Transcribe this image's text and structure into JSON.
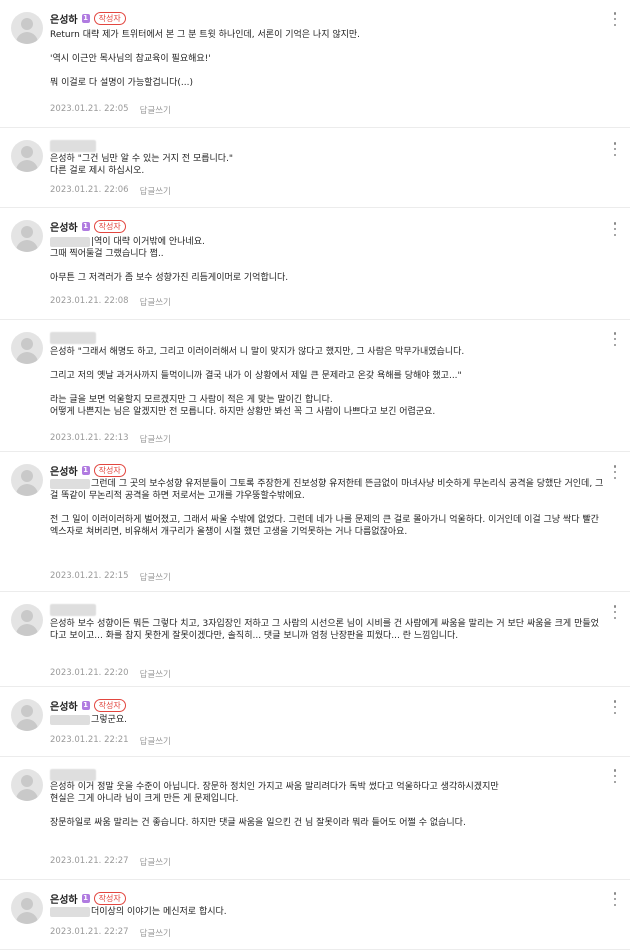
{
  "labels": {
    "writer_badge": "작성자",
    "reply": "답글쓰기",
    "level": "1"
  },
  "comments": [
    {
      "author": "은성하",
      "writer": true,
      "lines": [
        {
          "text": "Return 대략 제가 트위터에서 본 그 분 트윗 하나인데, 서론이 기억은 나지 않지만."
        },
        {
          "text": ""
        },
        {
          "text": "'역시 이근안 목사님의 참교육이 필요해요!'"
        },
        {
          "text": ""
        },
        {
          "text": "뭐 이걸로 다 설명이 가능할겁니다(...)"
        }
      ],
      "date": "2023.01.21. 22:05"
    },
    {
      "author": "은성하",
      "writer": false,
      "hidden_name": true,
      "lines": [
        {
          "text": "은성하 \"그건 님만 알 수 있는 거지 전 모릅니다.\""
        },
        {
          "text": "다른 걸로 제시 하십시오."
        }
      ],
      "date": "2023.01.21. 22:06"
    },
    {
      "author": "은성하",
      "writer": true,
      "lines": [
        {
          "text": "|역이 대략 이거밖에 안나네요.",
          "blur": true
        },
        {
          "text": "그때 찍어둘걸 그랬습니다 쩝.."
        },
        {
          "text": ""
        },
        {
          "text": "아무튼 그 저격러가 좀 보수 성향가진 리듬게이머로 기억합니다."
        }
      ],
      "date": "2023.01.21. 22:08"
    },
    {
      "author": "은성하",
      "writer": false,
      "hidden_name": true,
      "lines": [
        {
          "text": "은성하 \"그래서 해명도 하고, 그리고 이러이러해서 니 말이 맞지가 않다고 했지만, 그 사람은 막무가내였습니다."
        },
        {
          "text": ""
        },
        {
          "text": "그리고 저의 옛날 과거사까지 들먹이니까 결국 내가 이 상황에서 제일 큰 문제라고 온갖 욕해를 당해야 했고...\""
        },
        {
          "text": ""
        },
        {
          "text": "라는 글을 보면 억울할지 모르겠지만 그 사람이 적은 게 맞는 말이긴 합니다."
        },
        {
          "text": "어떻게 나쁜지는 님은 알겠지만 전 모릅니다. 하지만 상황만 봐선 꼭 그 사람이 나쁘다고 보긴 어렵군요."
        }
      ],
      "date": "2023.01.21. 22:13"
    },
    {
      "author": "은성하",
      "writer": true,
      "lines": [
        {
          "text": "그런데 그 곳의 보수성향 유저분들이 그토록 주장한게 진보성향 유저한테 뜬금없이 마녀사냥 비슷하게 무논리식 공격을 당했단 거인데, 그걸 똑같이 무논리적 공격을 하면 저로서는 고개를 갸우뚱할수밖에요.",
          "blur": true,
          "wrap": true
        },
        {
          "text": ""
        },
        {
          "text": "전 그 일이 이러이러하게 벌어졌고, 그래서 싸울 수밖에 없었다. 그런데 네가 나를 문제의 큰 걸로 몰아가니 억울하다. 이거인데 이걸 그냥 싹다 빨간 엑스자로 쳐버리면, 비유해서 개구리가 올챙이 시절 했던 고생을 기억못하는 거나 다름없잖아요.",
          "wrap": true
        }
      ],
      "date": "2023.01.21. 22:15"
    },
    {
      "author": "은성하",
      "writer": false,
      "hidden_name": true,
      "lines": [
        {
          "text": "은성하 보수 성향이든 뭐든 그렇다 치고, 3자입장인 저하고 그 사람의 시선으론 님이 시비를 건 사람에게 싸움을 말리는 거 보단 싸움을 크게 만들었다고 보이고... 화를 참지 못한게 잘못이겠다만, 솔직히... 댓글 보니까 엄청 난장판을 피웠다... 란 느낌입니다.",
          "wrap": true
        }
      ],
      "date": "2023.01.21. 22:20"
    },
    {
      "author": "은성하",
      "writer": true,
      "lines": [
        {
          "text": "그렇군요.",
          "blur": true
        }
      ],
      "date": "2023.01.21. 22:21"
    },
    {
      "author": "은성하",
      "writer": false,
      "hidden_name": true,
      "lines": [
        {
          "text": "은성하 이거 정말 웃을 수준이 아닙니다. 장문하 정치인 가지고 싸움 말리려다가 독박 썼다고 억울하다고 생각하시겠지만",
          "wrap": true
        },
        {
          "text": "현실은 그게 아니라 님이 크게 만든 게 문제입니다."
        },
        {
          "text": ""
        },
        {
          "text": "장문하일로 싸움 말리는 건 좋습니다. 하지만 댓글 싸움을 일으킨 건 님 잘못이라 뭐라 들어도 어쩔 수 없습니다."
        }
      ],
      "date": "2023.01.21. 22:27"
    },
    {
      "author": "은성하",
      "writer": true,
      "lines": [
        {
          "text": "더이상의 이야기는 메신저로 합시다.",
          "blur": true
        }
      ],
      "date": "2023.01.21. 22:27"
    }
  ]
}
